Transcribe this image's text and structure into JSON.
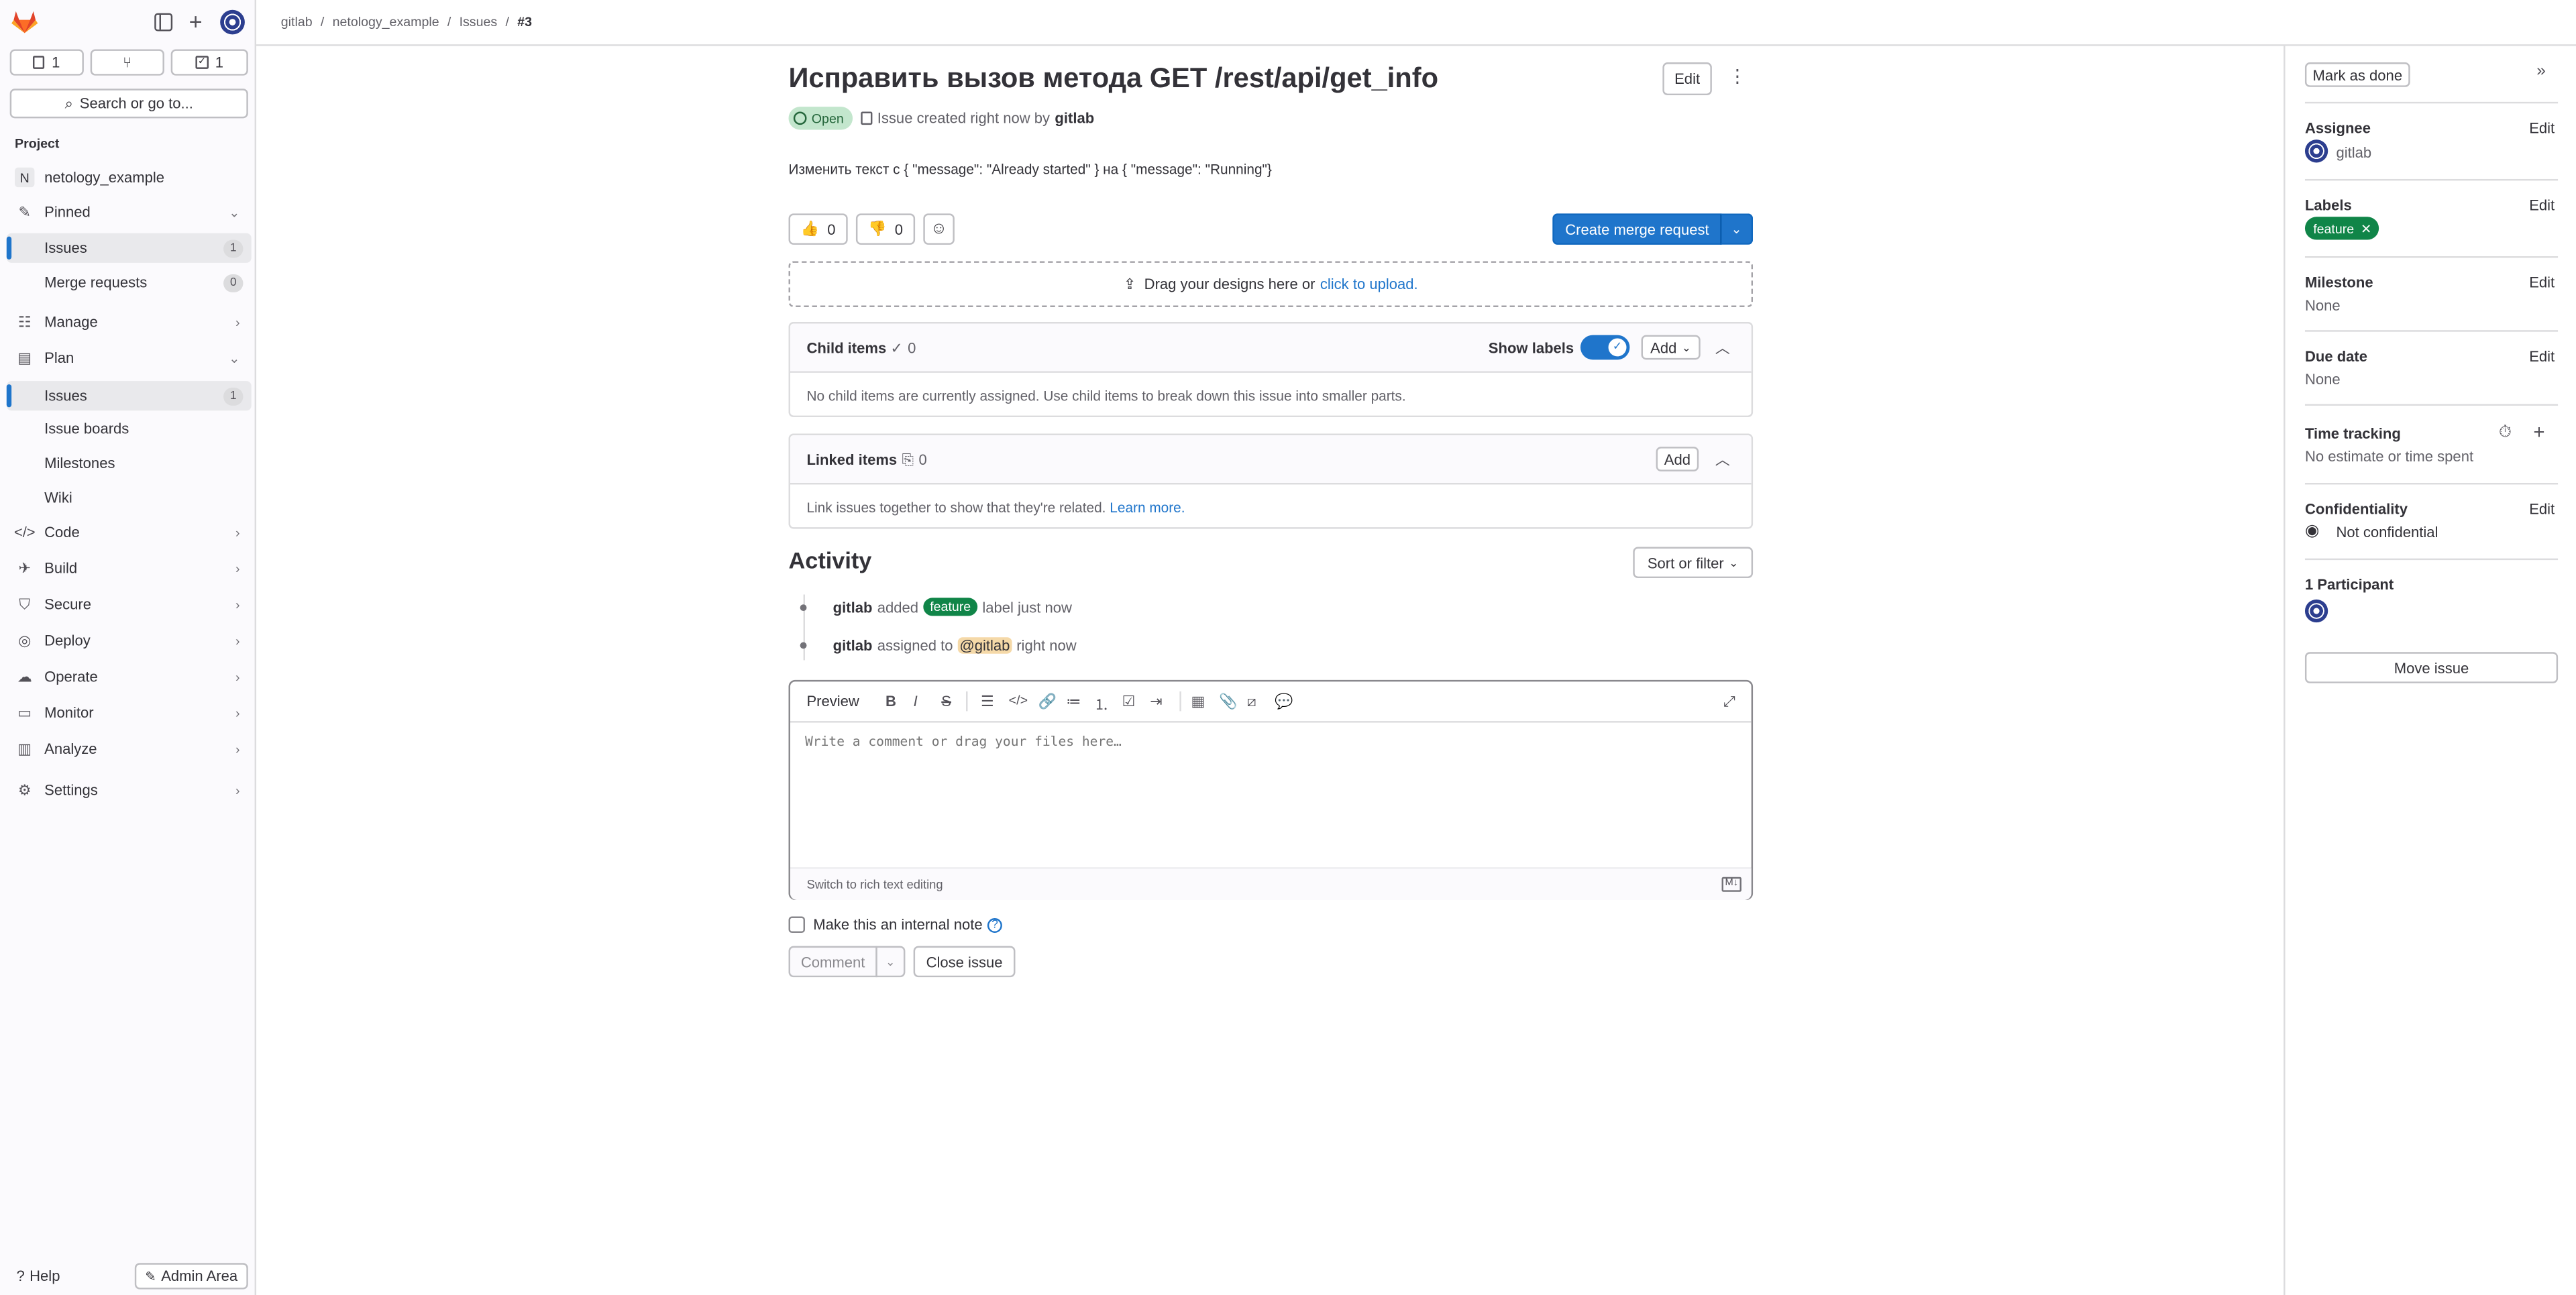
{
  "topbar": {
    "breadcrumb": [
      "gitlab",
      "netology_example",
      "Issues",
      "#3"
    ]
  },
  "sidebar": {
    "counters": {
      "issues": "1",
      "merge_requests": "",
      "todos": "1"
    },
    "search_placeholder": "Search or go to...",
    "project_heading": "Project",
    "project_initial": "N",
    "project_name": "netology_example",
    "pinned": {
      "label": "Pinned",
      "items": [
        {
          "label": "Issues",
          "count": "1"
        },
        {
          "label": "Merge requests",
          "count": "0"
        }
      ]
    },
    "sections": {
      "manage": "Manage",
      "plan": "Plan",
      "plan_items": [
        {
          "label": "Issues",
          "count": "1"
        },
        {
          "label": "Issue boards"
        },
        {
          "label": "Milestones"
        },
        {
          "label": "Wiki"
        }
      ],
      "code": "Code",
      "build": "Build",
      "secure": "Secure",
      "deploy": "Deploy",
      "operate": "Operate",
      "monitor": "Monitor",
      "analyze": "Analyze",
      "settings": "Settings"
    },
    "help": "Help",
    "admin": "Admin Area"
  },
  "issue": {
    "title": "Исправить вызов метода GET /rest/api/get_info",
    "edit_label": "Edit",
    "status": "Open",
    "meta_prefix": "Issue created right now by",
    "author": "gitlab",
    "description": "Изменить текст с { \"message\": \"Already started\" } на { \"message\": \"Running\"}",
    "thumbs_up": "0",
    "thumbs_down": "0",
    "create_mr": "Create merge request",
    "upload_text": "Drag your designs here or",
    "upload_link": "click to upload."
  },
  "child_items": {
    "title": "Child items",
    "count": "0",
    "show_labels": "Show labels",
    "add": "Add",
    "empty": "No child items are currently assigned. Use child items to break down this issue into smaller parts."
  },
  "linked_items": {
    "title": "Linked items",
    "count": "0",
    "add": "Add",
    "empty_text": "Link issues together to show that they're related.",
    "learn_more": "Learn more."
  },
  "activity": {
    "title": "Activity",
    "sort": "Sort or filter",
    "events": [
      {
        "user": "gitlab",
        "pre": "added",
        "label": "feature",
        "post": "label just now"
      },
      {
        "user": "gitlab",
        "pre": "assigned to",
        "mention": "@gitlab",
        "post": "right now"
      }
    ]
  },
  "editor": {
    "preview": "Preview",
    "placeholder": "Write a comment or drag your files here…",
    "switch": "Switch to rich text editing",
    "md_badge": "M↓"
  },
  "comment": {
    "internal_note": "Make this an internal note",
    "comment_btn": "Comment",
    "close_btn": "Close issue"
  },
  "rightbar": {
    "mark_done": "Mark as done",
    "assignee_title": "Assignee",
    "assignee": "gitlab",
    "labels_title": "Labels",
    "label": "feature",
    "milestone_title": "Milestone",
    "milestone": "None",
    "due_title": "Due date",
    "due": "None",
    "time_title": "Time tracking",
    "time": "No estimate or time spent",
    "conf_title": "Confidentiality",
    "conf": "Not confidential",
    "participants": "1 Participant",
    "move": "Move issue",
    "edit": "Edit"
  },
  "colors": {
    "accent": "#1f75cb",
    "open": "#108548",
    "label": "#108548"
  }
}
